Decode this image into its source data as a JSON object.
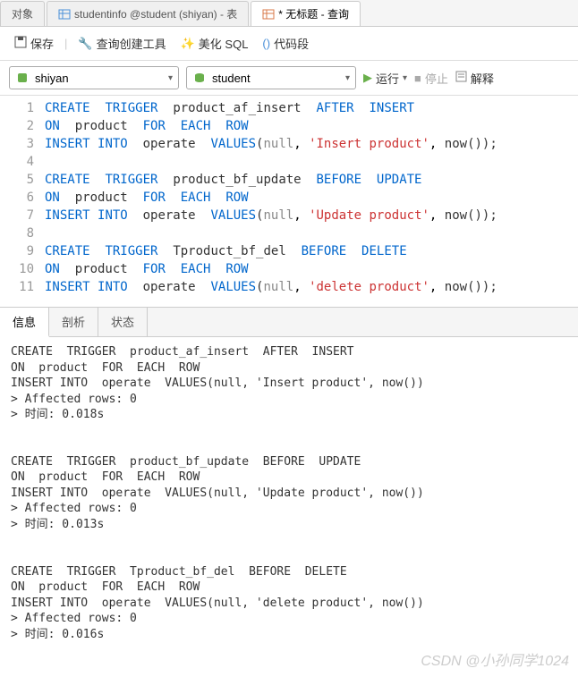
{
  "tabs": {
    "obj": "对象",
    "table": "studentinfo @student (shiyan) - 表",
    "query": "* 无标题 - 查询"
  },
  "toolbar": {
    "save": "保存",
    "query_builder": "查询创建工具",
    "beautify": "美化 SQL",
    "code": "代码段"
  },
  "dropdowns": {
    "conn": "shiyan",
    "db": "student",
    "run": "运行",
    "stop": "停止",
    "explain": "解释"
  },
  "code": {
    "create": "CREATE",
    "trigger": "TRIGGER",
    "after": "AFTER",
    "before": "BEFORE",
    "insert": "INSERT",
    "update": "UPDATE",
    "delete": "DELETE",
    "on": "ON",
    "for": "FOR",
    "each": "EACH",
    "row": "ROW",
    "into": "INTO",
    "values": "VALUES",
    "null": "null",
    "now": "now",
    "product": "product",
    "operate": "operate",
    "trig1": "product_af_insert",
    "trig2": "product_bf_update",
    "trig3": "Tproduct_bf_del",
    "str1": "'Insert product'",
    "str2": "'Update product'",
    "str3": "'delete product'"
  },
  "result_tabs": {
    "info": "信息",
    "profile": "剖析",
    "status": "状态"
  },
  "output": {
    "block1_l1": "CREATE  TRIGGER  product_af_insert  AFTER  INSERT",
    "block1_l2": "ON  product  FOR  EACH  ROW",
    "block1_l3": "INSERT INTO  operate  VALUES(null, 'Insert product', now())",
    "block1_l4": "> Affected rows: 0",
    "block1_l5": "> 时间: 0.018s",
    "block2_l1": "CREATE  TRIGGER  product_bf_update  BEFORE  UPDATE",
    "block2_l2": "ON  product  FOR  EACH  ROW",
    "block2_l3": "INSERT INTO  operate  VALUES(null, 'Update product', now())",
    "block2_l4": "> Affected rows: 0",
    "block2_l5": "> 时间: 0.013s",
    "block3_l1": "CREATE  TRIGGER  Tproduct_bf_del  BEFORE  DELETE",
    "block3_l2": "ON  product  FOR  EACH  ROW",
    "block3_l3": "INSERT INTO  operate  VALUES(null, 'delete product', now())",
    "block3_l4": "> Affected rows: 0",
    "block3_l5": "> 时间: 0.016s"
  },
  "watermark": "CSDN @小孙同学1024"
}
